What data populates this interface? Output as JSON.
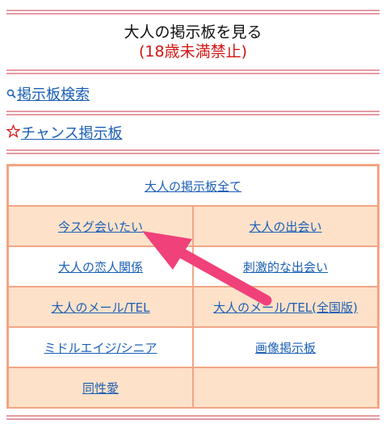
{
  "header": {
    "title": "大人の掲示板を見る",
    "subtitle": "(18歳未満禁止)"
  },
  "nav": {
    "search": {
      "label": "掲示板検索",
      "icon": "magnifier-icon"
    },
    "chance": {
      "label": "チャンス掲示板",
      "icon": "star-outline-icon"
    }
  },
  "grid": {
    "all": "大人の掲示板全て",
    "items": [
      "今スグ会いたい",
      "大人の出会い",
      "大人の恋人関係",
      "刺激的な出会い",
      "大人のメール/TEL",
      "大人のメール/TEL(全国版)",
      "ミドルエイジ/シニア",
      "画像掲示板",
      "同性愛",
      ""
    ]
  },
  "colors": {
    "divider": "#e59aa3",
    "link": "#1b5fb6",
    "subtitle": "#d21414",
    "grid_border": "#f2a585",
    "grid_peach": "#fde1c9",
    "arrow": "#f0417a"
  }
}
